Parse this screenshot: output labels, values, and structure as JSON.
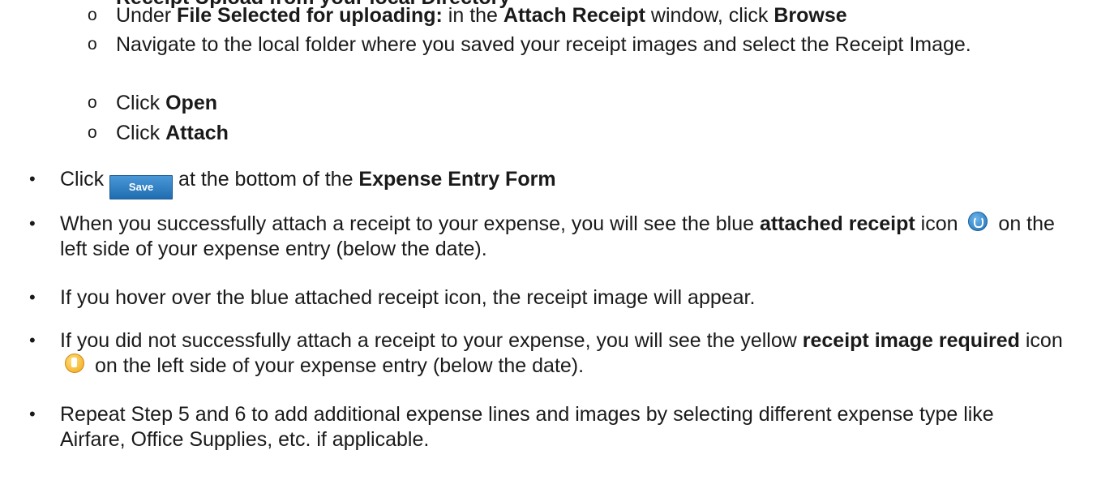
{
  "cut_line": {
    "text": "Receipt Upload from your local Directory"
  },
  "sub_items": [
    {
      "marker": "o",
      "pre": "Under ",
      "b1": "File Selected for uploading:",
      "mid": " in the ",
      "b2": "Attach Receipt",
      "mid2": " window, click ",
      "b3": "Browse"
    },
    {
      "marker": "o",
      "text": "Navigate to the local folder where you saved your receipt images and select the Receipt Image."
    },
    {
      "marker": "o",
      "pre": "Click ",
      "b1": "Open"
    },
    {
      "marker": "o",
      "pre": "Click ",
      "b1": "Attach"
    }
  ],
  "bullets": {
    "marker": "•",
    "save_line": {
      "pre": "Click ",
      "button_label": "Save",
      "post": " at the bottom of the ",
      "bold": "Expense Entry Form"
    },
    "attached_line": {
      "pre": "When you successfully attach a receipt to your expense, you will see the blue ",
      "bold1": "attached receipt",
      "mid": " icon ",
      "icon": "attached-receipt-icon",
      "post": " on the left side of your expense entry (below the date)."
    },
    "hover_line": {
      "text": "If you hover over the blue attached receipt icon, the receipt image will appear."
    },
    "required_line": {
      "pre": "If you did not successfully attach a receipt to your expense, you will see the yellow ",
      "bold1": "receipt image required",
      "mid": " icon ",
      "icon": "receipt-required-icon",
      "post": " on the left side of your expense entry (below the date)."
    },
    "repeat_line": {
      "text": "Repeat Step 5 and 6 to add additional expense lines  and images by selecting different expense type like Airfare, Office Supplies, etc. if applicable."
    }
  },
  "colors": {
    "save_button": "#2a7cc4",
    "attached_icon": "#1c6fb4",
    "required_icon": "#f1a61a"
  }
}
